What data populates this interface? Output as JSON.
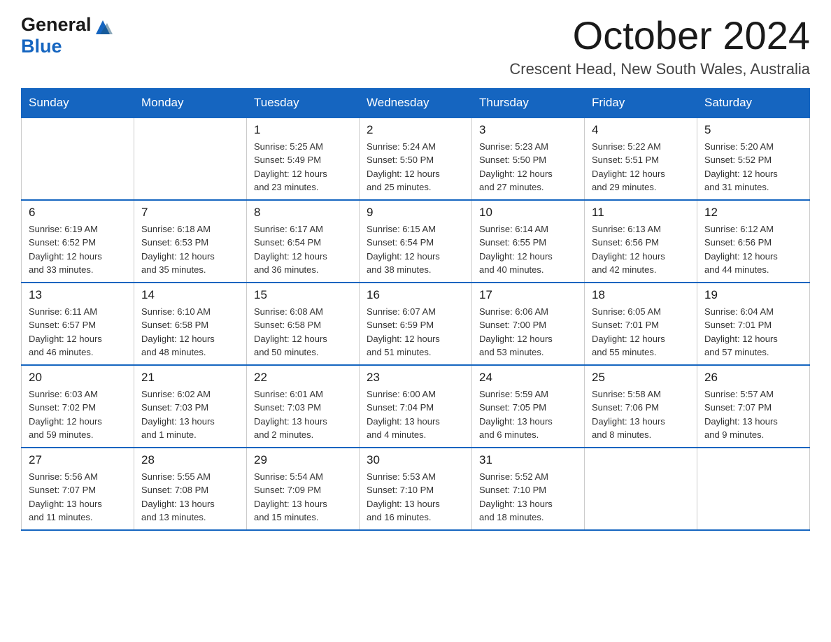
{
  "header": {
    "logo_general": "General",
    "logo_blue": "Blue",
    "title": "October 2024",
    "subtitle": "Crescent Head, New South Wales, Australia"
  },
  "calendar": {
    "days_of_week": [
      "Sunday",
      "Monday",
      "Tuesday",
      "Wednesday",
      "Thursday",
      "Friday",
      "Saturday"
    ],
    "weeks": [
      [
        {
          "day": "",
          "info": ""
        },
        {
          "day": "",
          "info": ""
        },
        {
          "day": "1",
          "info": "Sunrise: 5:25 AM\nSunset: 5:49 PM\nDaylight: 12 hours\nand 23 minutes."
        },
        {
          "day": "2",
          "info": "Sunrise: 5:24 AM\nSunset: 5:50 PM\nDaylight: 12 hours\nand 25 minutes."
        },
        {
          "day": "3",
          "info": "Sunrise: 5:23 AM\nSunset: 5:50 PM\nDaylight: 12 hours\nand 27 minutes."
        },
        {
          "day": "4",
          "info": "Sunrise: 5:22 AM\nSunset: 5:51 PM\nDaylight: 12 hours\nand 29 minutes."
        },
        {
          "day": "5",
          "info": "Sunrise: 5:20 AM\nSunset: 5:52 PM\nDaylight: 12 hours\nand 31 minutes."
        }
      ],
      [
        {
          "day": "6",
          "info": "Sunrise: 6:19 AM\nSunset: 6:52 PM\nDaylight: 12 hours\nand 33 minutes."
        },
        {
          "day": "7",
          "info": "Sunrise: 6:18 AM\nSunset: 6:53 PM\nDaylight: 12 hours\nand 35 minutes."
        },
        {
          "day": "8",
          "info": "Sunrise: 6:17 AM\nSunset: 6:54 PM\nDaylight: 12 hours\nand 36 minutes."
        },
        {
          "day": "9",
          "info": "Sunrise: 6:15 AM\nSunset: 6:54 PM\nDaylight: 12 hours\nand 38 minutes."
        },
        {
          "day": "10",
          "info": "Sunrise: 6:14 AM\nSunset: 6:55 PM\nDaylight: 12 hours\nand 40 minutes."
        },
        {
          "day": "11",
          "info": "Sunrise: 6:13 AM\nSunset: 6:56 PM\nDaylight: 12 hours\nand 42 minutes."
        },
        {
          "day": "12",
          "info": "Sunrise: 6:12 AM\nSunset: 6:56 PM\nDaylight: 12 hours\nand 44 minutes."
        }
      ],
      [
        {
          "day": "13",
          "info": "Sunrise: 6:11 AM\nSunset: 6:57 PM\nDaylight: 12 hours\nand 46 minutes."
        },
        {
          "day": "14",
          "info": "Sunrise: 6:10 AM\nSunset: 6:58 PM\nDaylight: 12 hours\nand 48 minutes."
        },
        {
          "day": "15",
          "info": "Sunrise: 6:08 AM\nSunset: 6:58 PM\nDaylight: 12 hours\nand 50 minutes."
        },
        {
          "day": "16",
          "info": "Sunrise: 6:07 AM\nSunset: 6:59 PM\nDaylight: 12 hours\nand 51 minutes."
        },
        {
          "day": "17",
          "info": "Sunrise: 6:06 AM\nSunset: 7:00 PM\nDaylight: 12 hours\nand 53 minutes."
        },
        {
          "day": "18",
          "info": "Sunrise: 6:05 AM\nSunset: 7:01 PM\nDaylight: 12 hours\nand 55 minutes."
        },
        {
          "day": "19",
          "info": "Sunrise: 6:04 AM\nSunset: 7:01 PM\nDaylight: 12 hours\nand 57 minutes."
        }
      ],
      [
        {
          "day": "20",
          "info": "Sunrise: 6:03 AM\nSunset: 7:02 PM\nDaylight: 12 hours\nand 59 minutes."
        },
        {
          "day": "21",
          "info": "Sunrise: 6:02 AM\nSunset: 7:03 PM\nDaylight: 13 hours\nand 1 minute."
        },
        {
          "day": "22",
          "info": "Sunrise: 6:01 AM\nSunset: 7:03 PM\nDaylight: 13 hours\nand 2 minutes."
        },
        {
          "day": "23",
          "info": "Sunrise: 6:00 AM\nSunset: 7:04 PM\nDaylight: 13 hours\nand 4 minutes."
        },
        {
          "day": "24",
          "info": "Sunrise: 5:59 AM\nSunset: 7:05 PM\nDaylight: 13 hours\nand 6 minutes."
        },
        {
          "day": "25",
          "info": "Sunrise: 5:58 AM\nSunset: 7:06 PM\nDaylight: 13 hours\nand 8 minutes."
        },
        {
          "day": "26",
          "info": "Sunrise: 5:57 AM\nSunset: 7:07 PM\nDaylight: 13 hours\nand 9 minutes."
        }
      ],
      [
        {
          "day": "27",
          "info": "Sunrise: 5:56 AM\nSunset: 7:07 PM\nDaylight: 13 hours\nand 11 minutes."
        },
        {
          "day": "28",
          "info": "Sunrise: 5:55 AM\nSunset: 7:08 PM\nDaylight: 13 hours\nand 13 minutes."
        },
        {
          "day": "29",
          "info": "Sunrise: 5:54 AM\nSunset: 7:09 PM\nDaylight: 13 hours\nand 15 minutes."
        },
        {
          "day": "30",
          "info": "Sunrise: 5:53 AM\nSunset: 7:10 PM\nDaylight: 13 hours\nand 16 minutes."
        },
        {
          "day": "31",
          "info": "Sunrise: 5:52 AM\nSunset: 7:10 PM\nDaylight: 13 hours\nand 18 minutes."
        },
        {
          "day": "",
          "info": ""
        },
        {
          "day": "",
          "info": ""
        }
      ]
    ]
  }
}
